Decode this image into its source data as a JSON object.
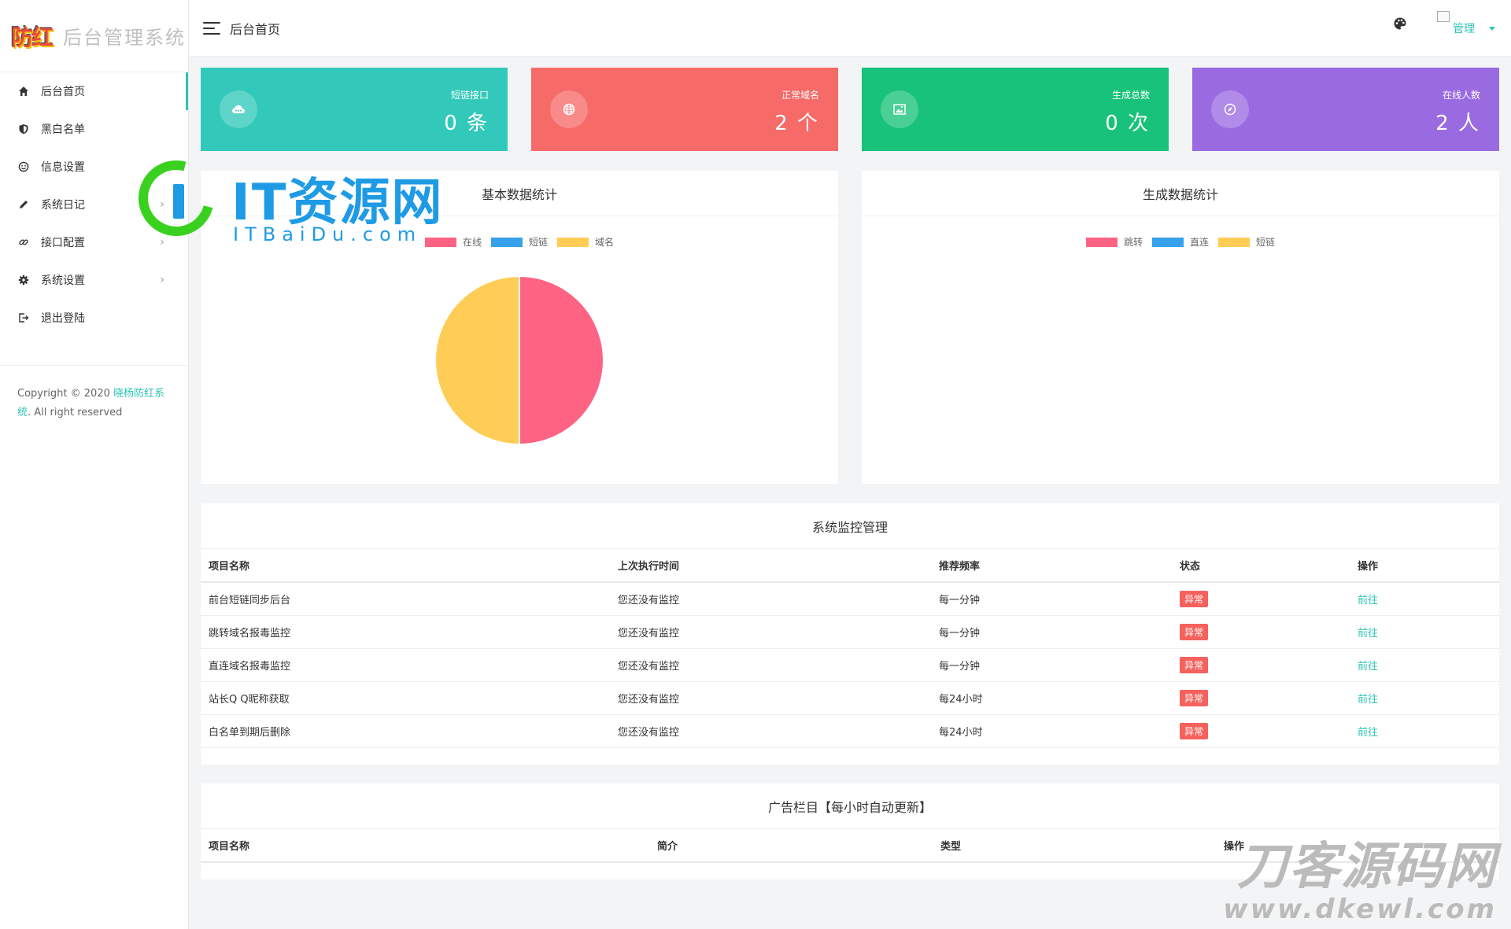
{
  "app": {
    "logo_mark": "防红",
    "title": "后台管理系统"
  },
  "sidebar": {
    "items": [
      {
        "label": "后台首页",
        "icon": "home-icon"
      },
      {
        "label": "黑白名单",
        "icon": "shield-icon"
      },
      {
        "label": "信息设置",
        "icon": "smile-icon"
      },
      {
        "label": "系统日记",
        "icon": "pencil-icon"
      },
      {
        "label": "接口配置",
        "icon": "link-icon"
      },
      {
        "label": "系统设置",
        "icon": "gear-icon"
      },
      {
        "label": "退出登陆",
        "icon": "logout-icon"
      }
    ],
    "copyright_prefix": "Copyright © 2020 ",
    "copyright_link": "晓杨防红系统",
    "copyright_suffix": ". All right reserved"
  },
  "header": {
    "breadcrumb": "后台首页",
    "user_name": "管理"
  },
  "stats": [
    {
      "label": "短链接口",
      "value": "0 条",
      "color": "#33c9ba",
      "icon": "cloud-icon"
    },
    {
      "label": "正常域名",
      "value": "2 个",
      "color": "#f66a68",
      "icon": "globe-icon"
    },
    {
      "label": "生成总数",
      "value": "0 次",
      "color": "#18c27a",
      "icon": "image-icon"
    },
    {
      "label": "在线人数",
      "value": "2 人",
      "color": "#9a6be0",
      "icon": "compass-icon"
    }
  ],
  "chart_panels": {
    "basic": {
      "title": "基本数据统计"
    },
    "generate": {
      "title": "生成数据统计"
    }
  },
  "chart_data": [
    {
      "type": "pie",
      "title": "基本数据统计",
      "categories": [
        "在线",
        "短链",
        "域名"
      ],
      "values": [
        2,
        0,
        2
      ],
      "colors": [
        "#ff6384",
        "#36a2eb",
        "#ffcd56"
      ],
      "legend": "top"
    },
    {
      "type": "pie",
      "title": "生成数据统计",
      "categories": [
        "跳转",
        "直连",
        "短链"
      ],
      "values": [
        0,
        0,
        0
      ],
      "colors": [
        "#ff6384",
        "#36a2eb",
        "#ffcd56"
      ],
      "legend": "top"
    }
  ],
  "monitor": {
    "title": "系统监控管理",
    "headers": [
      "项目名称",
      "上次执行时间",
      "推荐频率",
      "状态",
      "操作"
    ],
    "rows": [
      [
        "前台短链同步后台",
        "您还没有监控",
        "每一分钟",
        "异常",
        "前往"
      ],
      [
        "跳转域名报毒监控",
        "您还没有监控",
        "每一分钟",
        "异常",
        "前往"
      ],
      [
        "直连域名报毒监控",
        "您还没有监控",
        "每一分钟",
        "异常",
        "前往"
      ],
      [
        "站长Q Q昵称获取",
        "您还没有监控",
        "每24小时",
        "异常",
        "前往"
      ],
      [
        "白名单到期后删除",
        "您还没有监控",
        "每24小时",
        "异常",
        "前往"
      ]
    ]
  },
  "ads": {
    "title": "广告栏目【每小时自动更新】",
    "headers": [
      "项目名称",
      "简介",
      "类型",
      "操作"
    ]
  },
  "watermarks": {
    "it_big": "IT资源网",
    "it_small": "ITBaiDu.com",
    "dk_big": "刀客源码网",
    "dk_small": "www.dkewl.com"
  }
}
